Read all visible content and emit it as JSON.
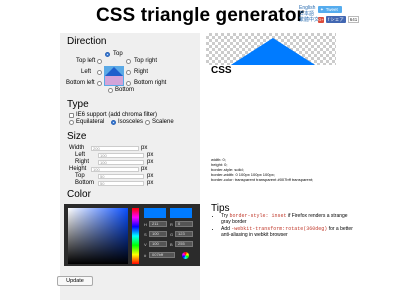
{
  "header": {
    "title": "CSS triangle generator",
    "languages": [
      "English",
      "日本語",
      "繁體中文"
    ],
    "tweet_label": "Tweet",
    "share_label": "シェア",
    "share_count": "641",
    "gplus_label": "G+"
  },
  "direction": {
    "heading": "Direction",
    "options": {
      "top": "Top",
      "top_left": "Top left",
      "top_right": "Top right",
      "left": "Left",
      "right": "Right",
      "bottom_left": "Bottom left",
      "bottom_right": "Bottom right",
      "bottom": "Bottom"
    },
    "selected": "Top"
  },
  "type": {
    "heading": "Type",
    "ie6": "IE6 support (add chroma filter)",
    "equilateral": "Equilateral",
    "isosceles": "Isosceles",
    "scalene": "Scalene",
    "selected": "Isosceles"
  },
  "size": {
    "heading": "Size",
    "width_label": "Width",
    "width_value": "200",
    "left_label": "Left",
    "left_value": "100",
    "right_label": "Right",
    "right_value": "100",
    "height_label": "Height",
    "height_value": "100",
    "top_label": "Top",
    "top_value": "50",
    "bottom_label": "Bottom",
    "bottom_value": "50",
    "unit": "px"
  },
  "color": {
    "heading": "Color",
    "hex": "007bff",
    "r": "0",
    "g": "123",
    "b": "255",
    "h": "211",
    "s": "100",
    "v": "100",
    "swatch_new": "#007bff",
    "swatch_current": "#007bff"
  },
  "update_label": "Update",
  "css": {
    "heading": "CSS",
    "code": "width: 0;\nheight: 0;\nborder-style: solid;\nborder-width: 0 100px 100px 100px;\nborder-color: transparent transparent #007bff transparent;"
  },
  "tips": {
    "heading": "Tips",
    "tip1_prefix": "Try ",
    "tip1_code": "border-style: inset",
    "tip1_suffix": " if Firefox renders a strange gray border",
    "tip2_prefix": "Add ",
    "tip2_code": "-webkit-transform:rotate(360deg)",
    "tip2_suffix": " for a better anti-aliasing in webkit browser"
  },
  "colors": {
    "triangle": "#007bff",
    "panel_bg": "#efefef",
    "picker_bg": "#2b2b2b"
  }
}
